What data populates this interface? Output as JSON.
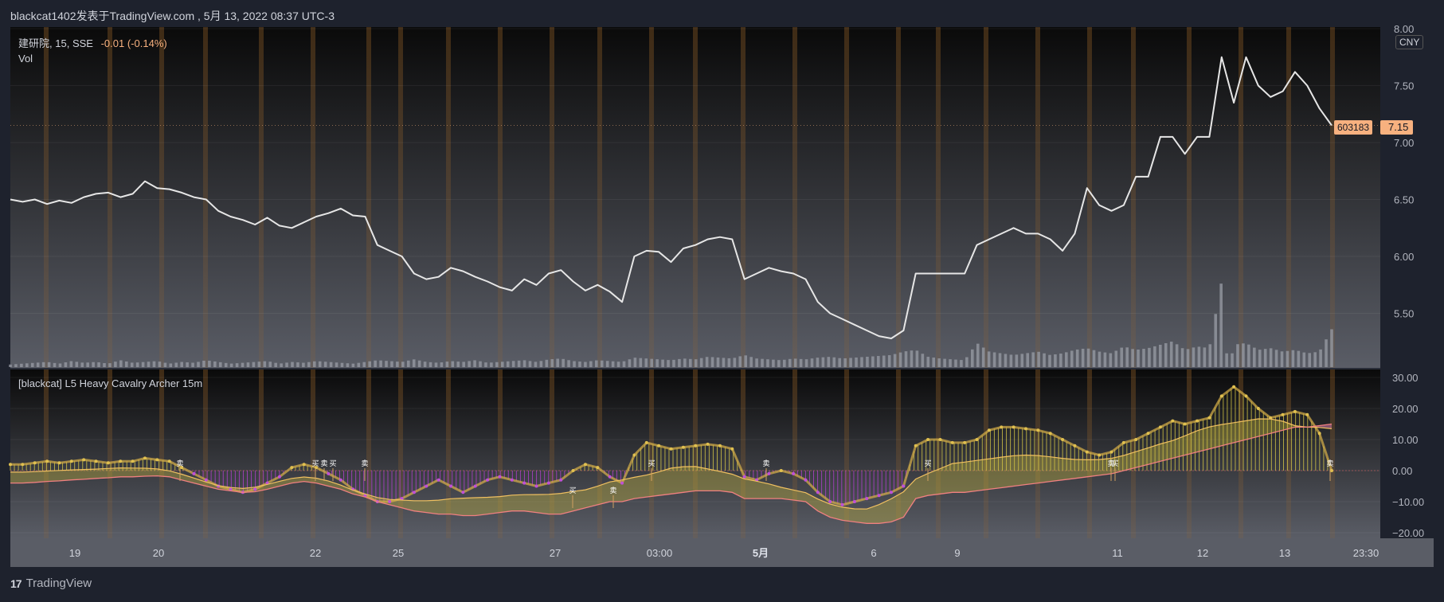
{
  "header": {
    "publisher": "blackcat1402发表于TradingView.com",
    "date": "5月 13, 2022 08:37 UTC-3"
  },
  "price_pane": {
    "symbol": "建研院",
    "interval": "15",
    "exchange": "SSE",
    "change": "-0.01",
    "change_pct": "(-0.14%)",
    "vol_label": "Vol",
    "currency": "CNY",
    "last_price": "7.15",
    "last_ticker": "603183",
    "y_ticks": [
      "8.00",
      "7.50",
      "7.00",
      "6.50",
      "6.00",
      "5.50"
    ]
  },
  "indicator_pane": {
    "title": "[blackcat] L5 Heavy Cavalry Archer 15m",
    "y_ticks": [
      "30.00",
      "20.00",
      "10.00",
      "0.00",
      "−10.00",
      "−20.00"
    ]
  },
  "x_axis": {
    "ticks": [
      "19",
      "20",
      "22",
      "25",
      "27",
      "03:00",
      "5月",
      "6",
      "9",
      "11",
      "12",
      "13",
      "23:30"
    ]
  },
  "signals": [
    {
      "label": "卖",
      "x": 226,
      "pos": "up"
    },
    {
      "label": "买",
      "x": 396,
      "pos": "up"
    },
    {
      "label": "卖",
      "x": 407,
      "pos": "up"
    },
    {
      "label": "买",
      "x": 418,
      "pos": "up"
    },
    {
      "label": "卖",
      "x": 458,
      "pos": "up"
    },
    {
      "label": "买",
      "x": 719,
      "pos": "down"
    },
    {
      "label": "卖",
      "x": 770,
      "pos": "down"
    },
    {
      "label": "买",
      "x": 818,
      "pos": "up"
    },
    {
      "label": "卖",
      "x": 962,
      "pos": "up"
    },
    {
      "label": "买",
      "x": 1165,
      "pos": "up"
    },
    {
      "label": "买",
      "x": 1400,
      "pos": "up"
    },
    {
      "label": "卖",
      "x": 1395,
      "pos": "up"
    },
    {
      "label": "卖",
      "x": 1670,
      "pos": "up"
    }
  ],
  "branding": {
    "name": "TradingView"
  },
  "colors": {
    "price_line": "#e6e6e6",
    "price_tag": "#f7b17f",
    "volume": "#9598a1",
    "osc_pos": "#e0d040",
    "osc_neg": "#c040e0",
    "session_band": "#a0682a"
  },
  "chart_data": [
    {
      "type": "line",
      "title": "建研院, 15, SSE",
      "series": [
        {
          "name": "建研院",
          "values": [
            6.5,
            6.48,
            6.5,
            6.46,
            6.49,
            6.47,
            6.52,
            6.55,
            6.56,
            6.52,
            6.55,
            6.66,
            6.6,
            6.59,
            6.56,
            6.52,
            6.5,
            6.4,
            6.35,
            6.32,
            6.28,
            6.34,
            6.27,
            6.25,
            6.3,
            6.35,
            6.38,
            6.42,
            6.36,
            6.35,
            6.1,
            6.05,
            6.0,
            5.85,
            5.8,
            5.82,
            5.9,
            5.87,
            5.82,
            5.78,
            5.73,
            5.7,
            5.8,
            5.75,
            5.85,
            5.88,
            5.78,
            5.7,
            5.75,
            5.69,
            5.6,
            6.0,
            6.05,
            6.04,
            5.95,
            6.07,
            6.1,
            6.15,
            6.17,
            6.15,
            5.8,
            5.85,
            5.9,
            5.87,
            5.85,
            5.8,
            5.6,
            5.5,
            5.45,
            5.4,
            5.35,
            5.3,
            5.28,
            5.35,
            5.85,
            5.85,
            5.85,
            5.85,
            5.85,
            6.1,
            6.15,
            6.2,
            6.25,
            6.2,
            6.2,
            6.15,
            6.05,
            6.2,
            6.6,
            6.45,
            6.4,
            6.45,
            6.7,
            6.7,
            7.05,
            7.05,
            6.9,
            7.05,
            7.05,
            7.75,
            7.35,
            7.75,
            7.5,
            7.4,
            7.45,
            7.62,
            7.5,
            7.3,
            7.15
          ]
        }
      ],
      "ylim": [
        5.0,
        8.0
      ]
    },
    {
      "type": "bar",
      "title": "Vol",
      "series": [
        {
          "name": "Vol",
          "values": [
            0.15,
            0.2,
            0.25,
            0.3,
            0.2,
            0.35,
            0.25,
            0.3,
            0.2,
            0.4,
            0.25,
            0.3,
            0.35,
            0.2,
            0.3,
            0.25,
            0.4,
            0.3,
            0.2,
            0.25,
            0.3,
            0.35,
            0.2,
            0.3,
            0.25,
            0.35,
            0.3,
            0.25,
            0.2,
            0.3,
            0.4,
            0.35,
            0.3,
            0.45,
            0.3,
            0.25,
            0.35,
            0.3,
            0.4,
            0.25,
            0.3,
            0.35,
            0.4,
            0.3,
            0.45,
            0.5,
            0.35,
            0.3,
            0.4,
            0.35,
            0.3,
            0.55,
            0.5,
            0.45,
            0.4,
            0.5,
            0.45,
            0.6,
            0.55,
            0.5,
            0.7,
            0.5,
            0.45,
            0.4,
            0.5,
            0.45,
            0.55,
            0.6,
            0.5,
            0.55,
            0.6,
            0.65,
            0.7,
            0.9,
            1.0,
            0.6,
            0.5,
            0.45,
            0.4,
            1.4,
            0.9,
            0.8,
            0.7,
            0.8,
            0.9,
            0.7,
            0.8,
            1.0,
            1.1,
            0.9,
            0.8,
            1.2,
            1.0,
            1.1,
            1.3,
            1.5,
            1.0,
            1.2,
            1.1,
            5.0,
            1.3,
            1.4,
            1.0,
            1.1,
            0.9,
            1.0,
            0.8,
            0.9,
            2.2
          ]
        }
      ]
    },
    {
      "type": "area",
      "title": "[blackcat] L5 Heavy Cavalry Archer 15m",
      "series": [
        {
          "name": "fast",
          "values": [
            2,
            2,
            2.5,
            3,
            2.5,
            3,
            3.5,
            3,
            2.5,
            3,
            3,
            4,
            3.5,
            3,
            1,
            -1,
            -3,
            -5,
            -6,
            -7,
            -6,
            -4,
            -2,
            1,
            2,
            1,
            -1,
            -3,
            -6,
            -8,
            -10,
            -10,
            -9,
            -7,
            -5,
            -3,
            -5,
            -7,
            -5,
            -3,
            -2,
            -3,
            -4,
            -5,
            -4,
            -3,
            0,
            2,
            1,
            -2,
            -4,
            5,
            9,
            8,
            7,
            7.5,
            8,
            8.5,
            8,
            7,
            -2,
            -3,
            -1,
            0,
            -1,
            -3,
            -7,
            -10,
            -11,
            -10,
            -9,
            -8,
            -7,
            -5,
            8,
            10,
            10,
            9,
            9,
            10,
            13,
            14,
            14,
            13.5,
            13,
            12,
            10,
            8,
            6,
            5,
            6,
            9,
            10,
            12,
            14,
            16,
            15,
            16,
            17,
            24,
            27,
            24,
            20,
            17,
            18,
            19,
            18,
            12,
            0
          ]
        },
        {
          "name": "slow",
          "values": [
            -4,
            -4,
            -3.8,
            -3.5,
            -3.3,
            -3,
            -2.8,
            -2.5,
            -2.3,
            -2,
            -2,
            -1.8,
            -1.7,
            -2,
            -3,
            -4,
            -5,
            -6,
            -6.5,
            -7,
            -6.8,
            -6,
            -5,
            -4,
            -3.5,
            -4,
            -5,
            -6,
            -7.5,
            -8.5,
            -10,
            -11,
            -12,
            -13,
            -13.5,
            -14,
            -14,
            -14.5,
            -14.5,
            -14,
            -13.5,
            -13,
            -13,
            -13.5,
            -14,
            -14,
            -13,
            -12,
            -11,
            -10,
            -10,
            -9,
            -8.5,
            -8,
            -7.5,
            -7,
            -6.5,
            -6.5,
            -6.5,
            -7,
            -9,
            -9,
            -9,
            -9,
            -9.5,
            -10,
            -13,
            -15,
            -16,
            -16.5,
            -17,
            -17,
            -16.5,
            -15,
            -9,
            -8,
            -7.5,
            -7,
            -7,
            -6.5,
            -6,
            -5.5,
            -5,
            -4.5,
            -4,
            -3.5,
            -3,
            -2.5,
            -2,
            -1.5,
            -1,
            0,
            1,
            2,
            3,
            4,
            5,
            6,
            7,
            8,
            9,
            10,
            11,
            12,
            13,
            14,
            14,
            14.5,
            15
          ]
        }
      ],
      "ylim": [
        -22,
        30
      ]
    }
  ]
}
